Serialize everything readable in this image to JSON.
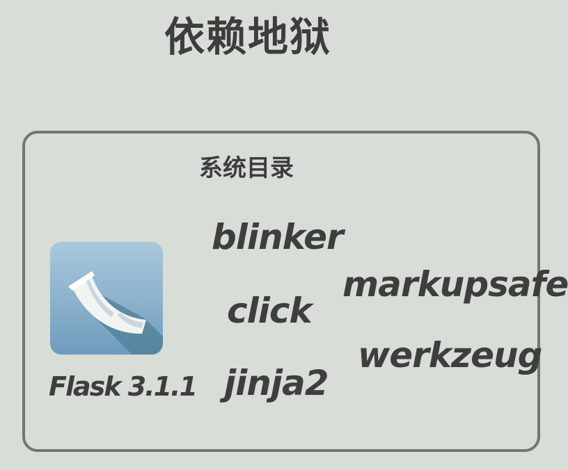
{
  "title": "依赖地狱",
  "box": {
    "label": "系统目录",
    "main_package": {
      "icon": "flask-horn-icon",
      "label": "Flask 3.1.1"
    },
    "dependencies_left": [
      "blinker",
      "click",
      "jinja2"
    ],
    "dependencies_right": [
      "markupsafe",
      "werkzeug"
    ]
  },
  "colors": {
    "background": "#d8ddd7",
    "frame_border": "#6c7a6c",
    "text": "#3b3e3b",
    "icon_bg_top": "#a9c8dc",
    "icon_bg_bottom": "#6e9bbd"
  }
}
